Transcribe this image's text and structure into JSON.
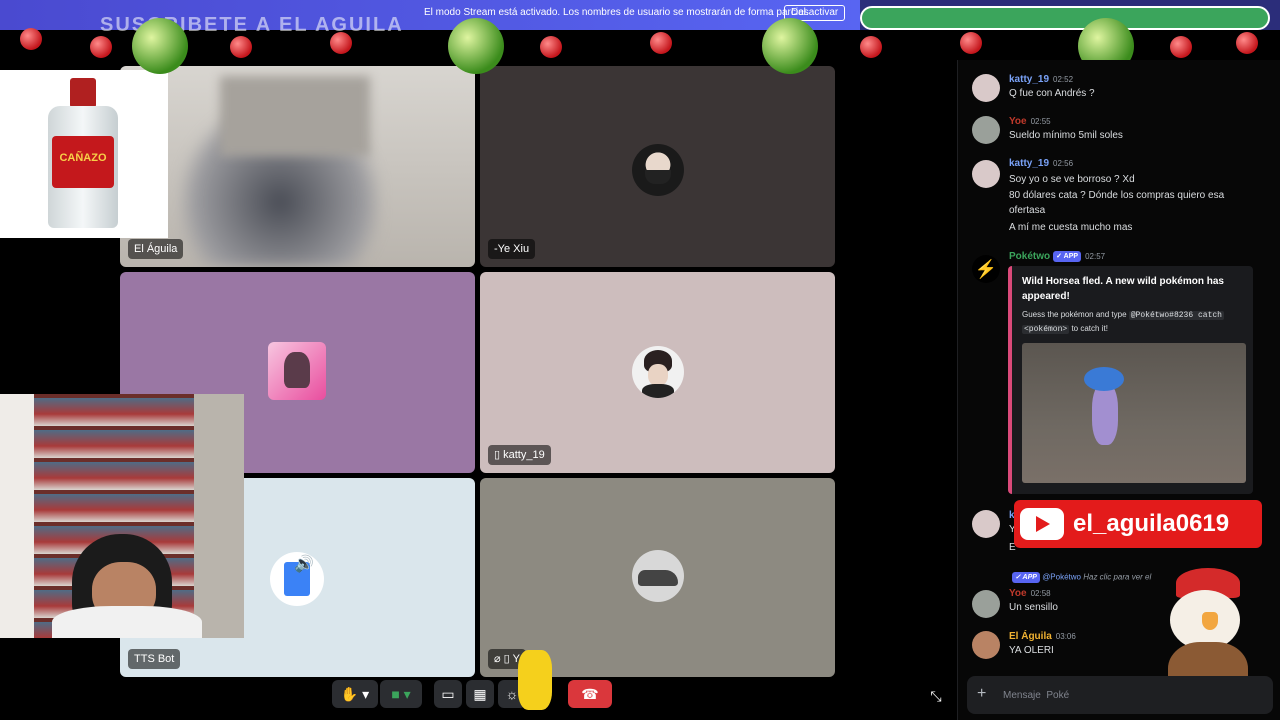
{
  "stream_notice": {
    "text": "El modo Stream está activado. Los nombres de usuario se mostrarán de forma parcial.",
    "button": "Desactivar"
  },
  "overlay_title": "SUSCRIBETE A EL AGUILA",
  "grid": {
    "tiles": [
      {
        "label": "El Águila"
      },
      {
        "label": "-Ye Xiu"
      },
      {
        "label": ""
      },
      {
        "label": "katty_19"
      },
      {
        "label": "TTS Bot"
      },
      {
        "label": "Y"
      }
    ]
  },
  "product": {
    "brand": "CAÑAZO"
  },
  "chat": {
    "messages": [
      {
        "name": "katty_19",
        "time": "02:52",
        "lines": [
          "Q fue con Andrés ?"
        ],
        "name_color": "#7aa2f7"
      },
      {
        "name": "Yoe",
        "time": "02:55",
        "lines": [
          "Sueldo mínimo 5mil soles"
        ],
        "name_color": "#c0392b"
      },
      {
        "name": "katty_19",
        "time": "02:56",
        "lines": [
          "Soy yo o se ve borroso ? Xd",
          "80 dólares cata ? Dónde los compras quiero esa",
          "ofertasa",
          "A mí me cuesta mucho mas"
        ],
        "name_color": "#7aa2f7"
      },
      {
        "name": "Pokétwo",
        "time": "02:57",
        "badge": "✓ APP",
        "name_color": "#3ba55c"
      }
    ],
    "embed": {
      "title": "Wild Horsea fled. A new wild pokémon has appeared!",
      "text_before": "Guess the pokémon and type",
      "code1": "@Pokétwo#8236 catch",
      "code2": "<pokémon>",
      "text_after": "to catch it!"
    },
    "after_embed": [
      {
        "name": "Yoe",
        "time": "02:58",
        "lines": [
          "Un sensillo"
        ],
        "name_color": "#c0392b"
      },
      {
        "name": "El Águila",
        "time": "03:06",
        "lines": [
          "YA OLERI"
        ],
        "name_color": "#f0b232"
      }
    ],
    "partial_initial_1": "k",
    "partial_initial_2": "Y",
    "partial_initial_3": "E",
    "reply_preview": {
      "badge": "✓ APP",
      "author": "@Pokétwo",
      "text": "Haz clic para ver el"
    },
    "input_placeholder": "Mensaje  Poké"
  },
  "youtube": {
    "handle": "el_aguila0619"
  },
  "colors": {
    "discord_blurple": "#5865f2",
    "hangup_red": "#da373c",
    "youtube_red": "#e31b1b"
  }
}
